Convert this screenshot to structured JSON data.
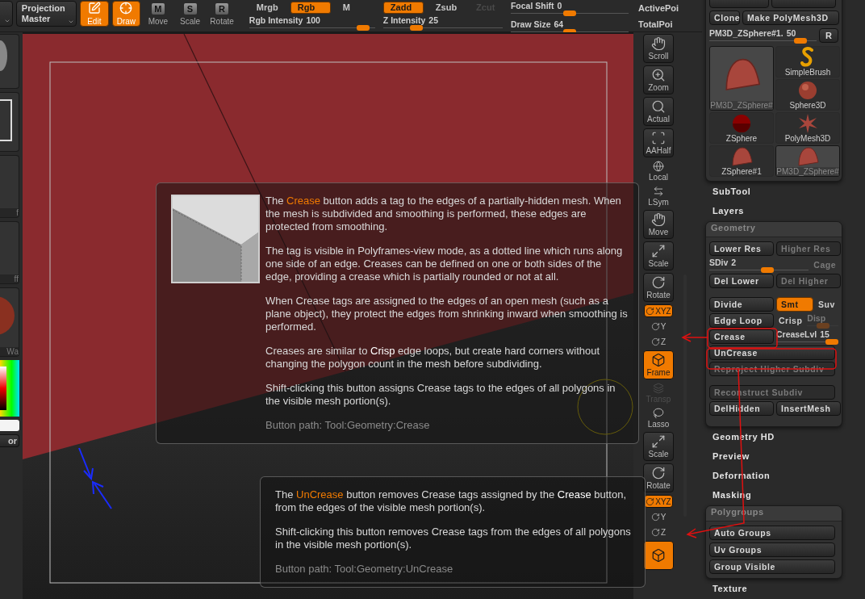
{
  "top_bar": {
    "projection_button": "Projection Master",
    "tools": [
      {
        "kind": "edit",
        "label": "Edit",
        "on": true
      },
      {
        "kind": "draw",
        "label": "Draw",
        "on": true
      },
      {
        "kind": "lettered",
        "glyph": "M",
        "label": "Move",
        "on": false
      },
      {
        "kind": "lettered",
        "glyph": "S",
        "label": "Scale",
        "on": false
      },
      {
        "kind": "lettered",
        "glyph": "R",
        "label": "Rotate",
        "on": false
      }
    ],
    "color_modes": [
      {
        "label": "Mrgb",
        "on": false,
        "disabled": false
      },
      {
        "label": "Rgb",
        "on": true,
        "disabled": false
      },
      {
        "label": "M",
        "on": false,
        "disabled": false
      }
    ],
    "sculpt_modes": [
      {
        "label": "Zadd",
        "on": true,
        "disabled": false
      },
      {
        "label": "Zsub",
        "on": false,
        "disabled": false
      },
      {
        "label": "Zcut",
        "on": false,
        "disabled": true
      }
    ],
    "sliders": [
      {
        "label": "Rgb Intensity",
        "reading": "100",
        "level": 0.95
      },
      {
        "label": "Z Intensity",
        "reading": "25",
        "level": 0.25
      },
      {
        "label": "Focal Shift",
        "reading": "0",
        "level": 0.5
      },
      {
        "label": "Draw Size",
        "reading": "64",
        "level": 0.5
      }
    ],
    "stats": [
      "ActivePoi",
      "TotalPoi"
    ]
  },
  "left_strip": {
    "swatch_labels": [
      "f",
      "ff",
      "Wa"
    ],
    "button": "or"
  },
  "toolbar": [
    {
      "kind": "tool",
      "label": "Scroll",
      "on": false,
      "disabled": false
    },
    {
      "kind": "tool",
      "label": "Zoom",
      "on": false,
      "disabled": false
    },
    {
      "kind": "tool",
      "label": "Actual",
      "on": false,
      "disabled": false
    },
    {
      "kind": "tool",
      "label": "AAHalf",
      "on": false,
      "disabled": false
    },
    {
      "kind": "plain",
      "label": "Local",
      "on": false,
      "disabled": false
    },
    {
      "kind": "plain",
      "label": "LSym",
      "on": false,
      "disabled": false
    },
    {
      "kind": "tool",
      "label": "Move",
      "on": false,
      "disabled": false
    },
    {
      "kind": "tool",
      "label": "Scale",
      "on": false,
      "disabled": false
    },
    {
      "kind": "tool",
      "label": "Rotate",
      "on": false,
      "disabled": false
    },
    {
      "kind": "toggle",
      "label": "XYZ",
      "on": true,
      "disabled": false
    },
    {
      "kind": "axis",
      "label": "Y",
      "on": false,
      "disabled": false
    },
    {
      "kind": "axis",
      "label": "Z",
      "on": false,
      "disabled": false
    },
    {
      "kind": "tool",
      "label": "Frame",
      "on": true,
      "disabled": false
    },
    {
      "kind": "plain",
      "label": "Transp",
      "on": false,
      "disabled": true
    },
    {
      "kind": "plain",
      "label": "Lasso",
      "on": false,
      "disabled": false
    },
    {
      "kind": "tool",
      "label": "Scale",
      "on": false,
      "disabled": false
    },
    {
      "kind": "tool",
      "label": "Rotate",
      "on": false,
      "disabled": false
    },
    {
      "kind": "toggle",
      "label": "XYZ",
      "on": true,
      "disabled": false
    },
    {
      "kind": "axis",
      "label": "Y",
      "on": false,
      "disabled": false
    },
    {
      "kind": "axis",
      "label": "Z",
      "on": false,
      "disabled": false
    },
    {
      "kind": "tool",
      "on": true,
      "disabled": false
    }
  ],
  "tooltips": [
    {
      "kind": "image",
      "lead": "The ",
      "name": "Crease",
      "rest": " button adds a tag to the edges of a partially-hidden mesh. When the mesh is subdivided and smoothing is performed, these edges are protected from smoothing.",
      "paragraphs": [
        "The tag is visible in Polyframes-view mode, as a dotted line which runs along one side of an edge. Creases can be defined on one or both sides of the edge, providing a crease which is partially rounded or not at all.",
        "When Crease tags are assigned to the edges of an open mesh (such as a plane object), they protect the edges from shrinking inward when smoothing is performed.",
        "Creases are similar to **Crisp** edge loops, but create hard corners without changing the polygon count in the mesh before subdividing.",
        "Shift-clicking this button assigns Crease tags to the edges of all polygons in the visible mesh portion(s)."
      ],
      "path": "Button path: Tool:Geometry:Crease"
    },
    {
      "kind": "text",
      "lead": "The ",
      "name": "UnCrease",
      "rest": " button removes Crease tags assigned by the **Crease** button, from the edges of the visible mesh portion(s).",
      "paragraphs": [
        "Shift-clicking this button removes Crease tags from the edges of all polygons in the visible mesh portion(s)."
      ],
      "path": "Button path: Tool:Geometry:UnCrease"
    }
  ],
  "tool_palette": {
    "header_buttons": [
      "Clone",
      "Make PolyMesh3D"
    ],
    "tool_slider": {
      "label": "PM3D_ZSphere#1.",
      "reading": "50",
      "level": 0.9
    },
    "reset_button": "R",
    "current_tool": {
      "kind": "bell",
      "label": "PM3D_ZSphere#",
      "selected": true
    },
    "tools": [
      {
        "kind": "brush",
        "label": "SimpleBrush",
        "selected": false
      },
      {
        "kind": "sphere",
        "label": "Sphere3D",
        "selected": false
      },
      {
        "kind": "zsphere",
        "label": "ZSphere",
        "selected": false
      },
      {
        "kind": "star",
        "label": "PolyMesh3D",
        "selected": false
      },
      {
        "kind": "bell",
        "label": "ZSphere#1",
        "selected": false
      },
      {
        "kind": "bell",
        "label": "PM3D_ZSphere#",
        "selected": true
      }
    ]
  },
  "sections_before": [
    "SubTool",
    "Layers"
  ],
  "geometry": {
    "title": "Geometry",
    "groups": [
      [
        [
          {
            "kind": "button",
            "label": "Lower Res",
            "on": false,
            "disabled": false
          },
          {
            "kind": "button",
            "label": "Higher Res",
            "on": false,
            "disabled": true
          }
        ],
        [
          {
            "kind": "slider",
            "label": "SDiv",
            "reading": "2",
            "level": 0.6,
            "on": false,
            "disabled": false
          },
          {
            "kind": "text",
            "label": "Cage",
            "on": false,
            "disabled": true
          }
        ],
        [
          {
            "kind": "button",
            "label": "Del Lower",
            "on": false,
            "disabled": false
          },
          {
            "kind": "button",
            "label": "Del Higher",
            "on": false,
            "disabled": true
          }
        ]
      ],
      [
        [
          {
            "kind": "button",
            "label": "Divide",
            "on": false,
            "disabled": false
          },
          {
            "kind": "toggle",
            "label": "Smt",
            "on": true,
            "disabled": false
          },
          {
            "kind": "text",
            "label": "Suv",
            "on": false,
            "disabled": false
          }
        ],
        [
          {
            "kind": "button",
            "label": "Edge Loop",
            "on": false,
            "disabled": false
          },
          {
            "kind": "text",
            "label": "Crisp",
            "on": false,
            "disabled": false
          },
          {
            "kind": "slider",
            "label": "Disp",
            "level": 0.5,
            "on": false,
            "disabled": true
          }
        ],
        [
          {
            "kind": "button",
            "label": "Crease",
            "on": false,
            "disabled": false
          },
          {
            "kind": "slider",
            "label": "CreaseLvl",
            "reading": "15",
            "level": 1,
            "on": false,
            "disabled": false
          }
        ],
        [
          {
            "kind": "wide",
            "label": "UnCrease",
            "on": false,
            "disabled": false
          }
        ],
        [
          {
            "kind": "wide",
            "label": "Reproject Higher Subdiv",
            "on": false,
            "disabled": true
          }
        ]
      ],
      [
        [
          {
            "kind": "wide",
            "label": "Reconstruct Subdiv",
            "on": false,
            "disabled": true
          }
        ],
        [
          {
            "kind": "button",
            "label": "DelHidden",
            "on": false,
            "disabled": false
          },
          {
            "kind": "button",
            "label": "InsertMesh",
            "on": false,
            "disabled": false
          }
        ]
      ]
    ]
  },
  "sections_after": [
    "Geometry HD",
    "Preview",
    "Deformation",
    "Masking"
  ],
  "polygroups": {
    "title": "Polygroups",
    "buttons": [
      "Auto Groups",
      "Uv Groups",
      "Group Visible"
    ]
  },
  "sections_end": [
    "Texture"
  ]
}
